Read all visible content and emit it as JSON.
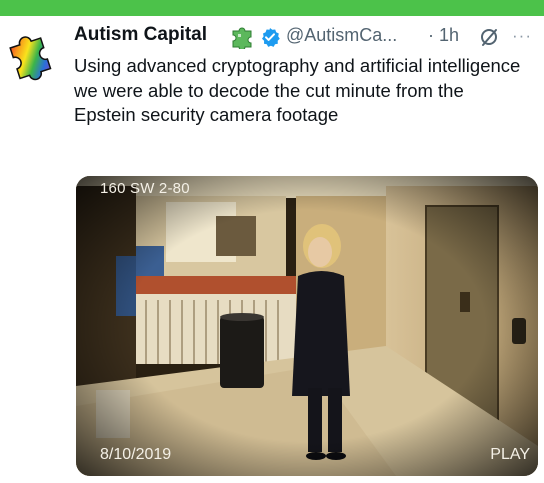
{
  "tweet": {
    "author_name": "Autism Capital",
    "handle": "@AutismCa...",
    "separator_time": "· 1h",
    "more": "···",
    "text": "Using advanced cryptography and artificial intelligence we were able to decode the cut minute from the Epstein security camera footage",
    "icons": {
      "avatar": "rainbow-puzzle-avatar",
      "name_emoji": "puzzle-piece-icon",
      "verified": "verified-badge-icon",
      "grok": "grok-icon",
      "more": "more-options-icon"
    }
  },
  "media": {
    "camera_label": "160 SW 2-80",
    "date": "8/10/2019",
    "status": "PLAY"
  },
  "colors": {
    "top_bar": "#4cc24a",
    "verified_blue": "#1d9bf0",
    "text": "#0f1419",
    "muted": "#536471"
  }
}
